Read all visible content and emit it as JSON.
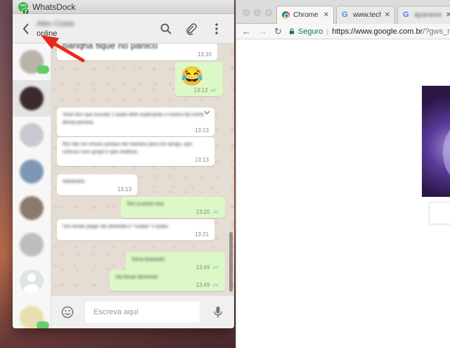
{
  "whatsdock": {
    "app_title": "WhatsDock",
    "unread_badge": "7",
    "header": {
      "contact_name": "Alex Costa",
      "status": "online"
    },
    "sidebar": {
      "contacts": [
        {
          "avatar_color": "#b9b3aa",
          "active": false,
          "has_badge": true
        },
        {
          "avatar_color": "#3a2c2a",
          "active": true,
          "has_badge": false
        },
        {
          "avatar_color": "#c9c7cf",
          "active": false,
          "has_badge": false
        },
        {
          "avatar_color": "#7d97b5",
          "active": false,
          "has_badge": false
        },
        {
          "avatar_color": "#8b7b6f",
          "active": false,
          "has_badge": false
        },
        {
          "avatar_color": "#bdbdbd",
          "active": false,
          "has_badge": false
        },
        {
          "avatar_color": "default",
          "active": false,
          "has_badge": false
        },
        {
          "avatar_color": "#e8dfb0",
          "active": false,
          "has_badge": true
        }
      ]
    },
    "messages": [
      {
        "direction": "in",
        "text": "banqha fique no pânico",
        "time": "13:10"
      },
      {
        "direction": "out",
        "emoji": "😂",
        "time": "13:12",
        "read": true
      },
      {
        "direction": "in",
        "text": "Você tem que escutar o áudio dele explicando o motivo da morte dessa pessoa.",
        "time": "13:13"
      },
      {
        "direction": "in",
        "text": "Ele não me enviou porque ele mandou para um amigo, que colocou num grupo e que viralizou.",
        "time": "13:13"
      },
      {
        "direction": "in",
        "text": "hahahaha",
        "time": "13:13"
      },
      {
        "direction": "out",
        "text": "Tem q achar isso",
        "time": "13:20",
        "read": true
      },
      {
        "direction": "in",
        "text": "Vou tentar pegar ele distraído e \"roubar\" o áudio.",
        "time": "13:21"
      },
      {
        "direction": "out",
        "text": "Toma distraído!",
        "time": "13:49",
        "read": true
      },
      {
        "direction": "out",
        "text": "Vai tomar dormindo",
        "time": "13:49",
        "read": true
      }
    ],
    "composer": {
      "placeholder": "Escreva aqui"
    },
    "icons": {
      "back": "chevron-left-icon",
      "search": "search-icon",
      "attach": "paperclip-icon",
      "menu": "more-vertical-icon",
      "emoji": "smiley-icon",
      "mic": "microphone-icon"
    },
    "colors": {
      "accent_green": "#3cb84a",
      "bubble_out": "#dcf8c6",
      "bubble_in": "#ffffff",
      "chat_bg": "#e5ddd3",
      "read_ticks": "#4fb6ec",
      "annotation_arrow": "#e8291f"
    }
  },
  "chrome": {
    "tabs": [
      {
        "label": "Chrome W",
        "favicon": "chrome",
        "active": true
      },
      {
        "label": "www.techt",
        "favicon": "google",
        "active": false
      },
      {
        "label": "aparamer",
        "favicon": "google",
        "active": false
      }
    ],
    "toolbar": {
      "back": "←",
      "forward": "→",
      "reload": "↻",
      "secure_label": "Seguro",
      "url_host": "https://www.google.com.br",
      "url_path": "/?gws_rd=s"
    }
  }
}
